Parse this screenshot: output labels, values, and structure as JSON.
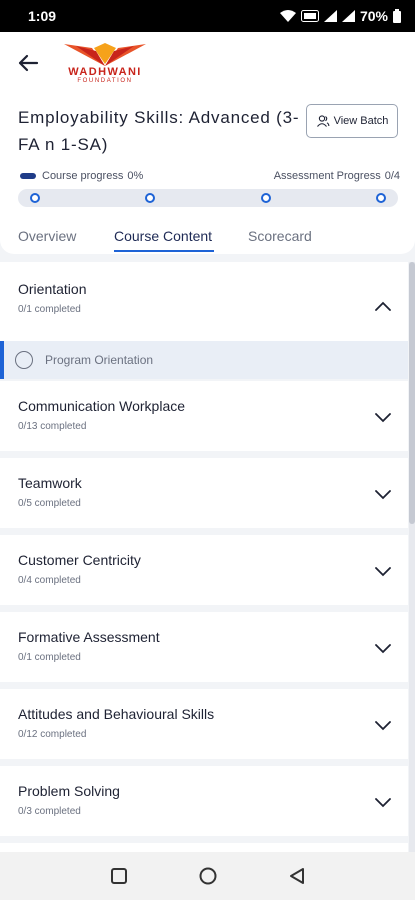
{
  "status_bar": {
    "time": "1:09",
    "battery": "70%"
  },
  "header": {
    "back_icon": "arrow-left-icon",
    "logo": {
      "wordmark": "WADHWANI",
      "sub": "FOUNDATION",
      "brand_color": "#c8241b"
    }
  },
  "course": {
    "title": "Employability Skills: Advanced (3-FA n 1-SA)",
    "view_batch_label": "View Batch",
    "course_progress_label": "Course progress",
    "course_progress_value": "0%",
    "course_progress_fraction": 0.0,
    "assessment_progress_label": "Assessment Progress",
    "assessment_progress_value": "0/4",
    "milestones": 4
  },
  "tabs": [
    {
      "label": "Overview",
      "active": false
    },
    {
      "label": "Course Content",
      "active": true
    },
    {
      "label": "Scorecard",
      "active": false
    }
  ],
  "modules": [
    {
      "title": "Orientation",
      "status": "0/1 completed",
      "expanded": true,
      "lessons": [
        {
          "title": "Program Orientation"
        }
      ]
    },
    {
      "title": "Communication Workplace",
      "status": "0/13 completed",
      "expanded": false
    },
    {
      "title": "Teamwork",
      "status": "0/5 completed",
      "expanded": false
    },
    {
      "title": "Customer Centricity",
      "status": "0/4 completed",
      "expanded": false
    },
    {
      "title": "Formative Assessment",
      "status": "0/1 completed",
      "expanded": false
    },
    {
      "title": "Attitudes and Behavioural Skills",
      "status": "0/12 completed",
      "expanded": false
    },
    {
      "title": "Problem Solving",
      "status": "0/3 completed",
      "expanded": false
    }
  ],
  "colors": {
    "accent": "#1e63d6",
    "progress": "#1f3c88",
    "lesson_highlight": "#e9eef6"
  }
}
